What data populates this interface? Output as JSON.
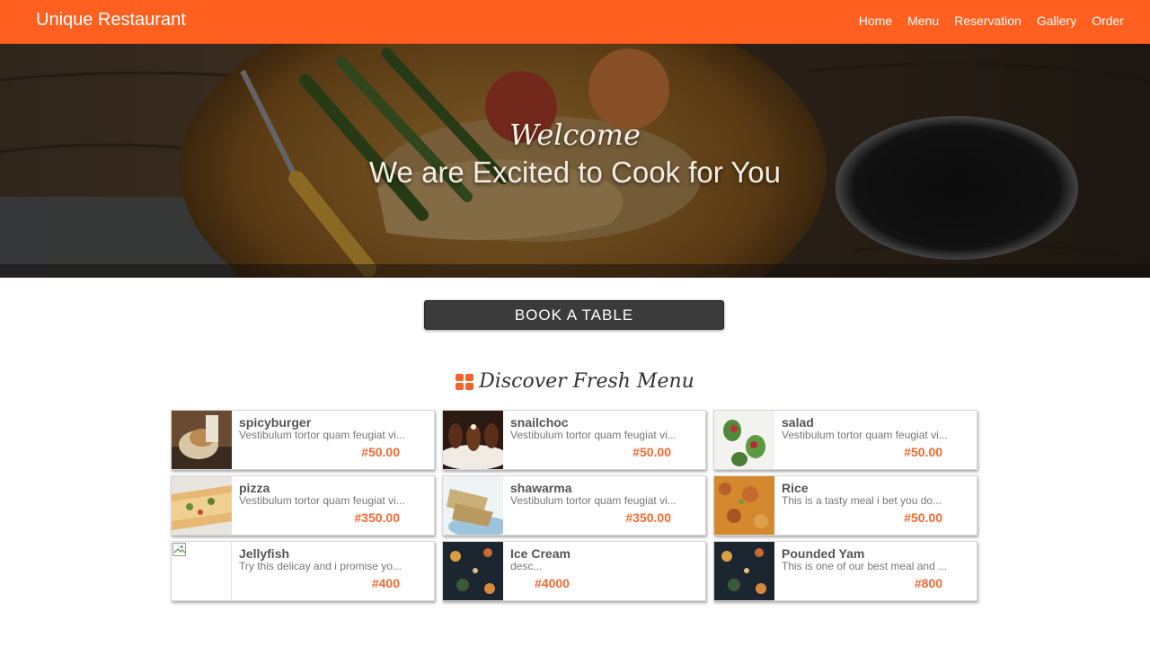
{
  "navbar": {
    "brand": "Unique Restaurant",
    "links": [
      "Home",
      "Menu",
      "Reservation",
      "Gallery",
      "Order"
    ],
    "color": "#ff5f1f"
  },
  "hero": {
    "welcome": "Welcome",
    "title": "We are Excited to Cook for You"
  },
  "book_button": "BOOK A TABLE",
  "menu_section": {
    "title": "Discover Fresh Menu",
    "icon": "grid-icon",
    "items": [
      {
        "name": "spicyburger",
        "desc": "Vestibulum tortor quam feugiat vi...",
        "price": "#50.00",
        "image": "burger-photo"
      },
      {
        "name": "snailchoc",
        "desc": "Vestibulum tortor quam feugiat vi...",
        "price": "#50.00",
        "image": "dessert-photo"
      },
      {
        "name": "salad",
        "desc": "Vestibulum tortor quam feugiat vi...",
        "price": "#50.00",
        "image": "salad-photo"
      },
      {
        "name": "pizza",
        "desc": "Vestibulum tortor quam feugiat vi...",
        "price": "#350.00",
        "image": "pizza-photo"
      },
      {
        "name": "shawarma",
        "desc": "Vestibulum tortor quam feugiat vi...",
        "price": "#350.00",
        "image": "shawarma-photo"
      },
      {
        "name": "Rice",
        "desc": "This is a tasty meal i bet you do...",
        "price": "#50.00",
        "image": "rice-photo"
      },
      {
        "name": "Jellyfish",
        "desc": "Try this delicay and i promise yo...",
        "price": "#400",
        "image": "broken-image-icon"
      },
      {
        "name": "Ice Cream",
        "desc": "desc...",
        "price": "#4000",
        "image": "dark-table-photo"
      },
      {
        "name": "Pounded Yam",
        "desc": "This is one of our best meal and ...",
        "price": "#800",
        "image": "dark-table-photo"
      }
    ]
  },
  "colors": {
    "accent": "#ff5f1f",
    "price": "#f26a32",
    "button": "#3b3b3b"
  }
}
